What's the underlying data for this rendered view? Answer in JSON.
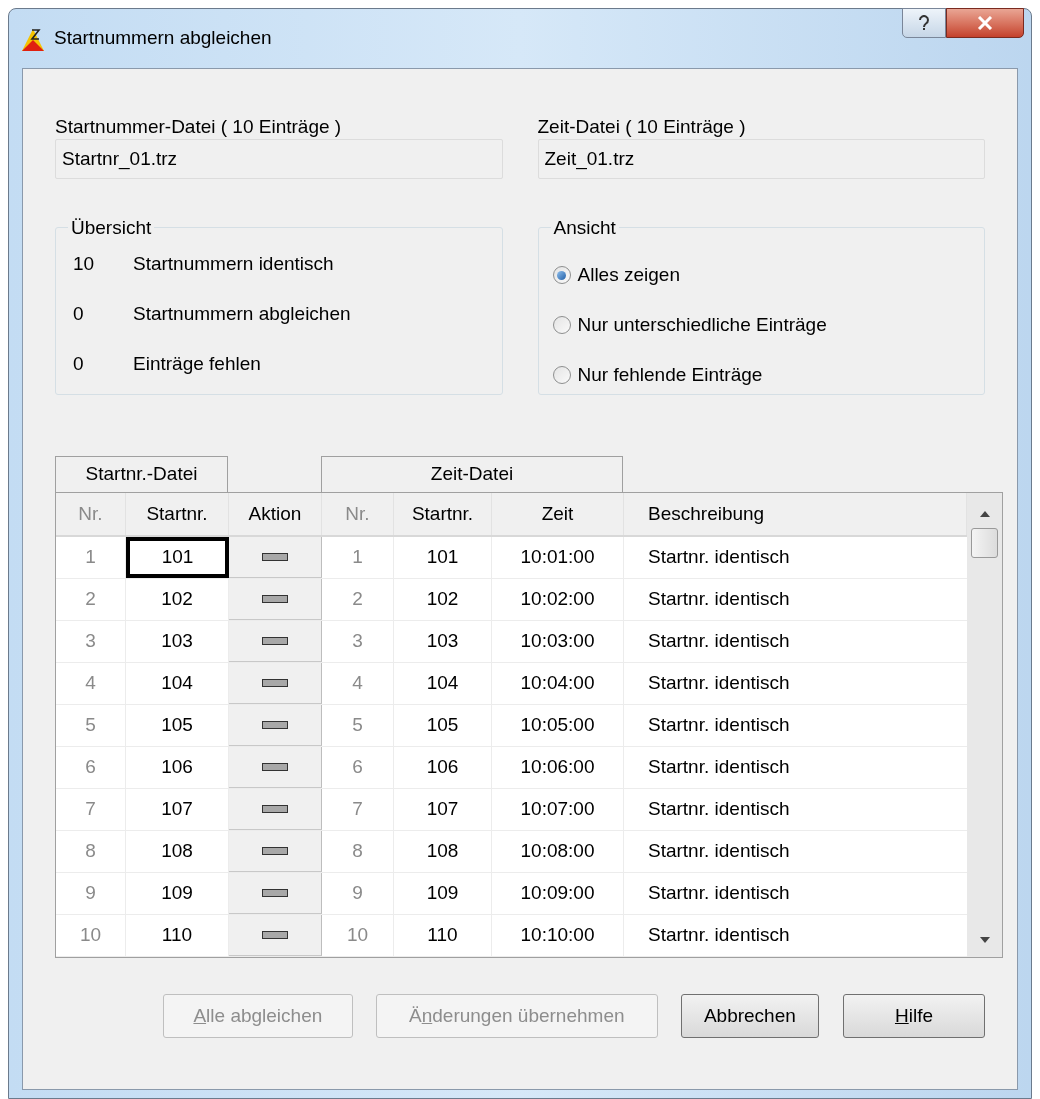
{
  "window": {
    "title": "Startnummern abgleichen"
  },
  "files": [
    {
      "label": "Startnummer-Datei ( 10 Einträge )",
      "value": "Startnr_01.trz"
    },
    {
      "label": "Zeit-Datei ( 10 Einträge )",
      "value": "Zeit_01.trz"
    }
  ],
  "overview": {
    "title": "Übersicht",
    "items": [
      {
        "count": "10",
        "text": "Startnummern identisch"
      },
      {
        "count": "0",
        "text": "Startnummern abgleichen"
      },
      {
        "count": "0",
        "text": "Einträge fehlen"
      }
    ]
  },
  "view": {
    "title": "Ansicht",
    "options": [
      {
        "label": "Alles zeigen",
        "selected": true
      },
      {
        "label": "Nur unterschiedliche Einträge",
        "selected": false
      },
      {
        "label": "Nur fehlende Einträge",
        "selected": false
      }
    ]
  },
  "table": {
    "groups": [
      "Startnr.-Datei",
      "Zeit-Datei"
    ],
    "columns": [
      "Nr.",
      "Startnr.",
      "Aktion",
      "Nr.",
      "Startnr.",
      "Zeit",
      "Beschreibung"
    ],
    "rows": [
      {
        "nr": "1",
        "startnr": "101",
        "nr_2": "1",
        "startnr_2": "101",
        "zeit": "10:01:00",
        "description": "Startnr. identisch",
        "focused": true
      },
      {
        "nr": "2",
        "startnr": "102",
        "nr_2": "2",
        "startnr_2": "102",
        "zeit": "10:02:00",
        "description": "Startnr. identisch",
        "focused": false
      },
      {
        "nr": "3",
        "startnr": "103",
        "nr_2": "3",
        "startnr_2": "103",
        "zeit": "10:03:00",
        "description": "Startnr. identisch",
        "focused": false
      },
      {
        "nr": "4",
        "startnr": "104",
        "nr_2": "4",
        "startnr_2": "104",
        "zeit": "10:04:00",
        "description": "Startnr. identisch",
        "focused": false
      },
      {
        "nr": "5",
        "startnr": "105",
        "nr_2": "5",
        "startnr_2": "105",
        "zeit": "10:05:00",
        "description": "Startnr. identisch",
        "focused": false
      },
      {
        "nr": "6",
        "startnr": "106",
        "nr_2": "6",
        "startnr_2": "106",
        "zeit": "10:06:00",
        "description": "Startnr. identisch",
        "focused": false
      },
      {
        "nr": "7",
        "startnr": "107",
        "nr_2": "7",
        "startnr_2": "107",
        "zeit": "10:07:00",
        "description": "Startnr. identisch",
        "focused": false
      },
      {
        "nr": "8",
        "startnr": "108",
        "nr_2": "8",
        "startnr_2": "108",
        "zeit": "10:08:00",
        "description": "Startnr. identisch",
        "focused": false
      },
      {
        "nr": "9",
        "startnr": "109",
        "nr_2": "9",
        "startnr_2": "109",
        "zeit": "10:09:00",
        "description": "Startnr. identisch",
        "focused": false
      },
      {
        "nr": "10",
        "startnr": "110",
        "nr_2": "10",
        "startnr_2": "110",
        "zeit": "10:10:00",
        "description": "Startnr. identisch",
        "focused": false
      }
    ]
  },
  "buttons": [
    {
      "key": "A",
      "after": "lle abgleichen",
      "disabled": true
    },
    {
      "before": "Ä",
      "key": "n",
      "after": "derungen übernehmen",
      "disabled": true
    },
    {
      "after": "Abbrechen",
      "disabled": false
    },
    {
      "key": "H",
      "after": "ilfe",
      "disabled": false
    }
  ]
}
